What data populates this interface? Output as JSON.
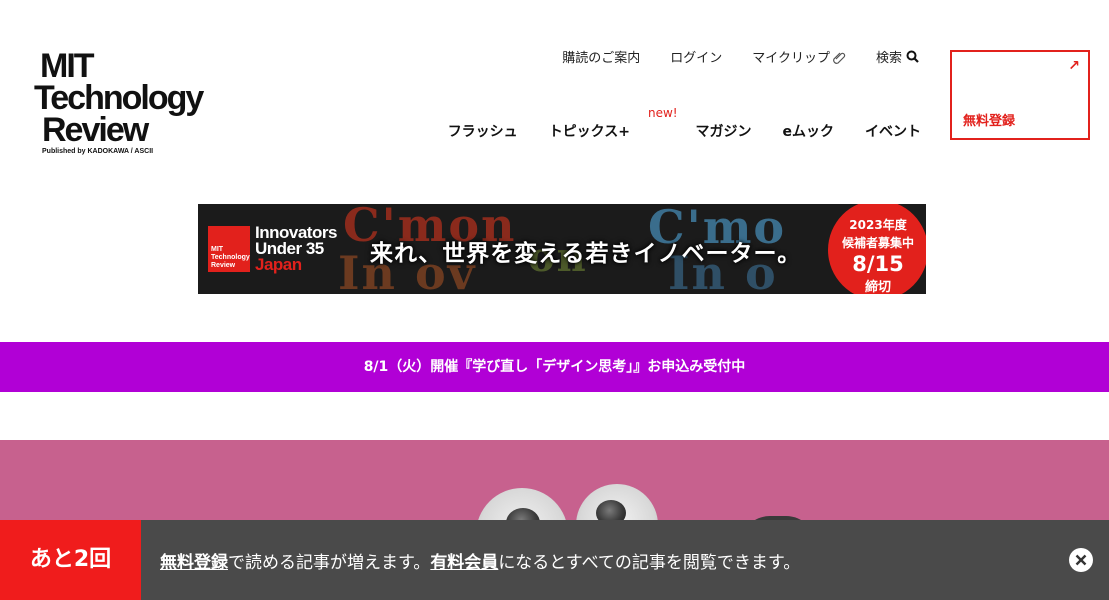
{
  "header": {
    "logo": {
      "line1": "MIT",
      "line2": "Technology",
      "line3": "Review",
      "sub": "Published by KADOKAWA / ASCII"
    },
    "top_links": {
      "subscribe": "購読のご案内",
      "login": "ログイン",
      "my_clip": "マイクリップ",
      "search": "検索"
    },
    "nav": {
      "flash": "フラッシュ",
      "topics": "トピックス+",
      "magazine": "マガジン",
      "magazine_badge": "new!",
      "emook": "eムック",
      "event": "イベント"
    },
    "register": {
      "label": "無料登録",
      "arrow": "↗"
    }
  },
  "banner": {
    "logo_small": "MIT Technology Review",
    "innovators_line1": "Innovators",
    "innovators_line2": "Under 35",
    "innovators_line3": "Japan",
    "headline": "来れ、世界を変える若きイノベーター。",
    "badge_year": "2023年度",
    "badge_recruit": "候補者募集中",
    "badge_date": "8/15",
    "badge_deadline": "締切"
  },
  "announcement": {
    "text": "8/1（火）開催『学び直し「デザイン思考」』お申込み受付中"
  },
  "bottom_bar": {
    "remaining": "あと2回",
    "link_free": "無料登録",
    "text1": "で読める記事が増えます。",
    "link_paid": "有料会員",
    "text2": "になるとすべての記事を閲覧できます。"
  },
  "colors": {
    "accent": "#e2211c",
    "announce_bg": "#b100d6",
    "hero_bg": "#c7618e",
    "bottom_bg": "#4a4a4a",
    "remaining_bg": "#f01c1c"
  },
  "icons": [
    "clip-icon",
    "search-icon",
    "external-arrow-icon",
    "close-icon"
  ]
}
